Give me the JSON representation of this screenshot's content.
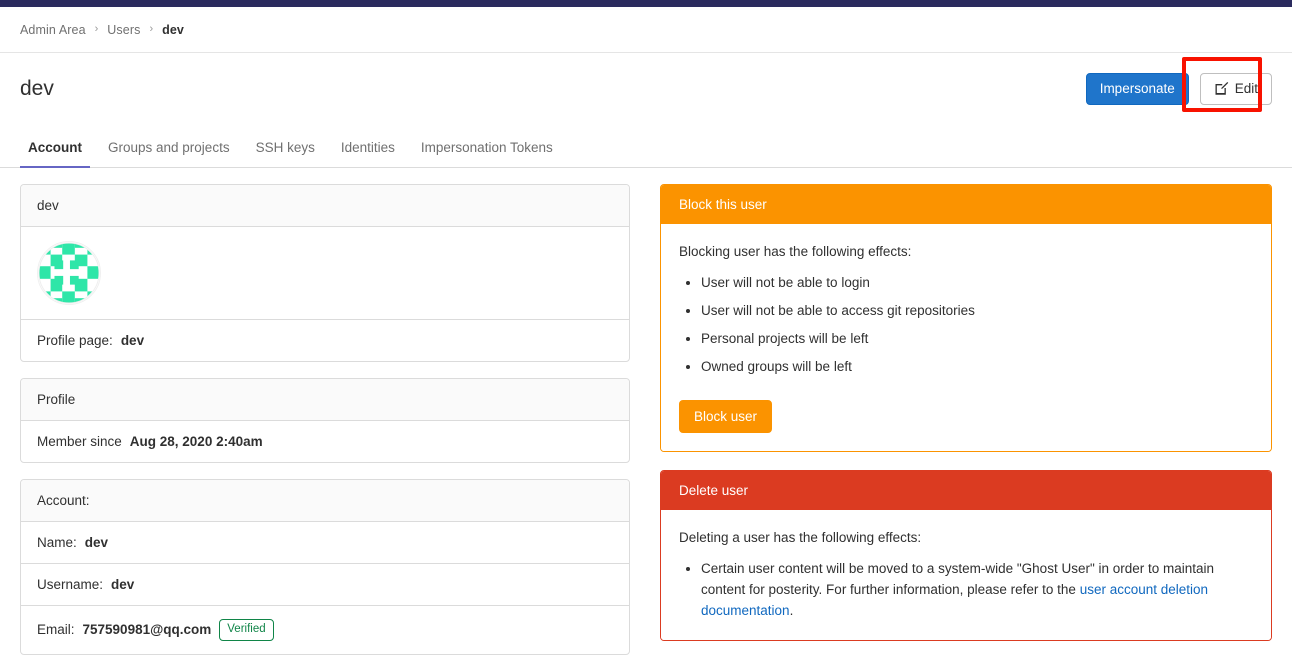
{
  "colors": {
    "topbar": "#2b2b5e",
    "primary_blue": "#1f75cb",
    "tab_active_underline": "#6666c4",
    "warning_orange": "#fb9300",
    "danger_red": "#db3b21",
    "verified_green": "#108548",
    "link_blue": "#1068bf",
    "highlight_red": "#f81200",
    "avatar_teal": "#2ee6a8"
  },
  "breadcrumb": {
    "items": [
      {
        "label": "Admin Area",
        "current": false
      },
      {
        "label": "Users",
        "current": false
      },
      {
        "label": "dev",
        "current": true
      }
    ],
    "separator": "›"
  },
  "header": {
    "title": "dev",
    "impersonate_label": "Impersonate",
    "edit_label": "Edit",
    "edit_icon": "pencil-square-icon"
  },
  "tabs": [
    {
      "label": "Account",
      "active": true
    },
    {
      "label": "Groups and projects",
      "active": false
    },
    {
      "label": "SSH keys",
      "active": false
    },
    {
      "label": "Identities",
      "active": false
    },
    {
      "label": "Impersonation Tokens",
      "active": false
    }
  ],
  "left": {
    "user_card": {
      "header": "dev",
      "avatar_alt": "user-identicon-avatar",
      "profile_page_label": "Profile page:",
      "profile_page_value": "dev"
    },
    "profile_card": {
      "header": "Profile",
      "member_since_label": "Member since",
      "member_since_value": "Aug 28, 2020 2:40am"
    },
    "account_card": {
      "header": "Account:",
      "name_label": "Name:",
      "name_value": "dev",
      "username_label": "Username:",
      "username_value": "dev",
      "email_label": "Email:",
      "email_value": "757590981@qq.com",
      "email_badge": "Verified"
    }
  },
  "right": {
    "block_panel": {
      "heading": "Block this user",
      "intro": "Blocking user has the following effects:",
      "effects": [
        "User will not be able to login",
        "User will not be able to access git repositories",
        "Personal projects will be left",
        "Owned groups will be left"
      ],
      "button_label": "Block user"
    },
    "delete_panel": {
      "heading": "Delete user",
      "intro": "Deleting a user has the following effects:",
      "effect_text_before": "Certain user content will be moved to a system-wide \"Ghost User\" in order to maintain content for posterity. For further information, please refer to the ",
      "effect_link_text": "user account deletion documentation",
      "effect_text_after": "."
    }
  }
}
